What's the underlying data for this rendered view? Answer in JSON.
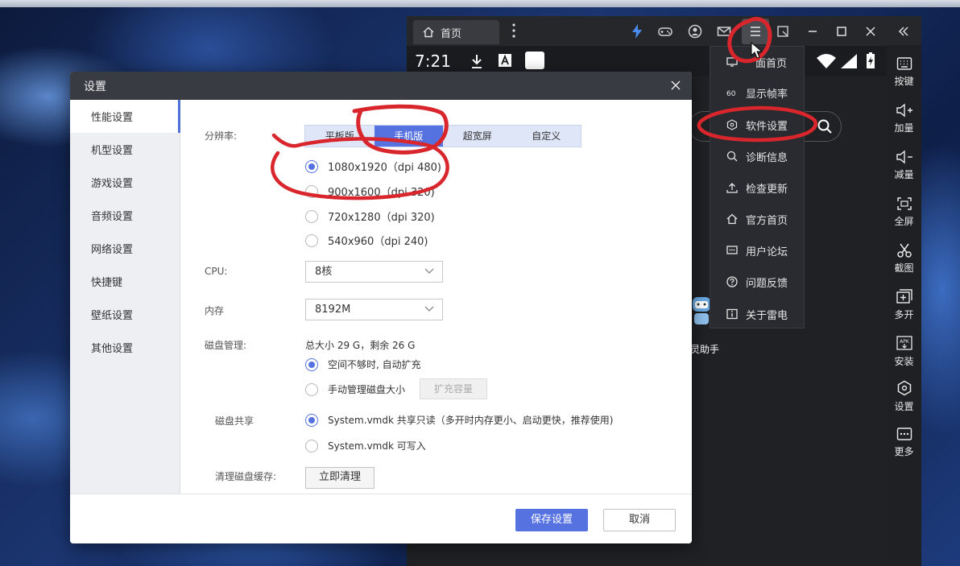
{
  "emulator": {
    "tab_label": "首页",
    "status_time": "7:21",
    "app_label": "灵助手"
  },
  "menu": {
    "items": [
      "桌面首页",
      "显示帧率",
      "软件设置",
      "诊断信息",
      "检查更新",
      "官方首页",
      "用户论坛",
      "问题反馈",
      "关于雷电"
    ],
    "item0_visible": "面首页"
  },
  "sidebar": {
    "items": [
      "按键",
      "加量",
      "减量",
      "全屏",
      "截图",
      "多开",
      "安装",
      "设置",
      "更多"
    ]
  },
  "dialog": {
    "title": "设置",
    "nav": [
      "性能设置",
      "机型设置",
      "游戏设置",
      "音频设置",
      "网络设置",
      "快捷键",
      "壁纸设置",
      "其他设置"
    ],
    "resolution_label": "分辨率:",
    "resolution_tabs": [
      "平板版",
      "手机版",
      "超宽屏",
      "自定义"
    ],
    "resolution_options": [
      "1080x1920（dpi 480)",
      "900x1600（dpi 320)",
      "720x1280（dpi 320)",
      "540x960（dpi 240)"
    ],
    "cpu_label": "CPU:",
    "cpu_value": "8核",
    "mem_label": "内存",
    "mem_value": "8192M",
    "disk_label": "磁盘管理:",
    "disk_info": "总大小 29 G，剩余 26 G",
    "disk_auto": "空间不够时, 自动扩充",
    "disk_manual": "手动管理磁盘大小",
    "expand_btn": "扩充容量",
    "share_label": "磁盘共享",
    "share_ro": "System.vmdk 共享只读（多开时内存更小、启动更快，推荐使用)",
    "share_rw": "System.vmdk 可写入",
    "clean_label": "清理磁盘缓存:",
    "clean_btn": "立即清理",
    "save_btn": "保存设置",
    "cancel_btn": "取消"
  },
  "colors": {
    "accent": "#5572e0",
    "annotation": "#d9262c"
  }
}
